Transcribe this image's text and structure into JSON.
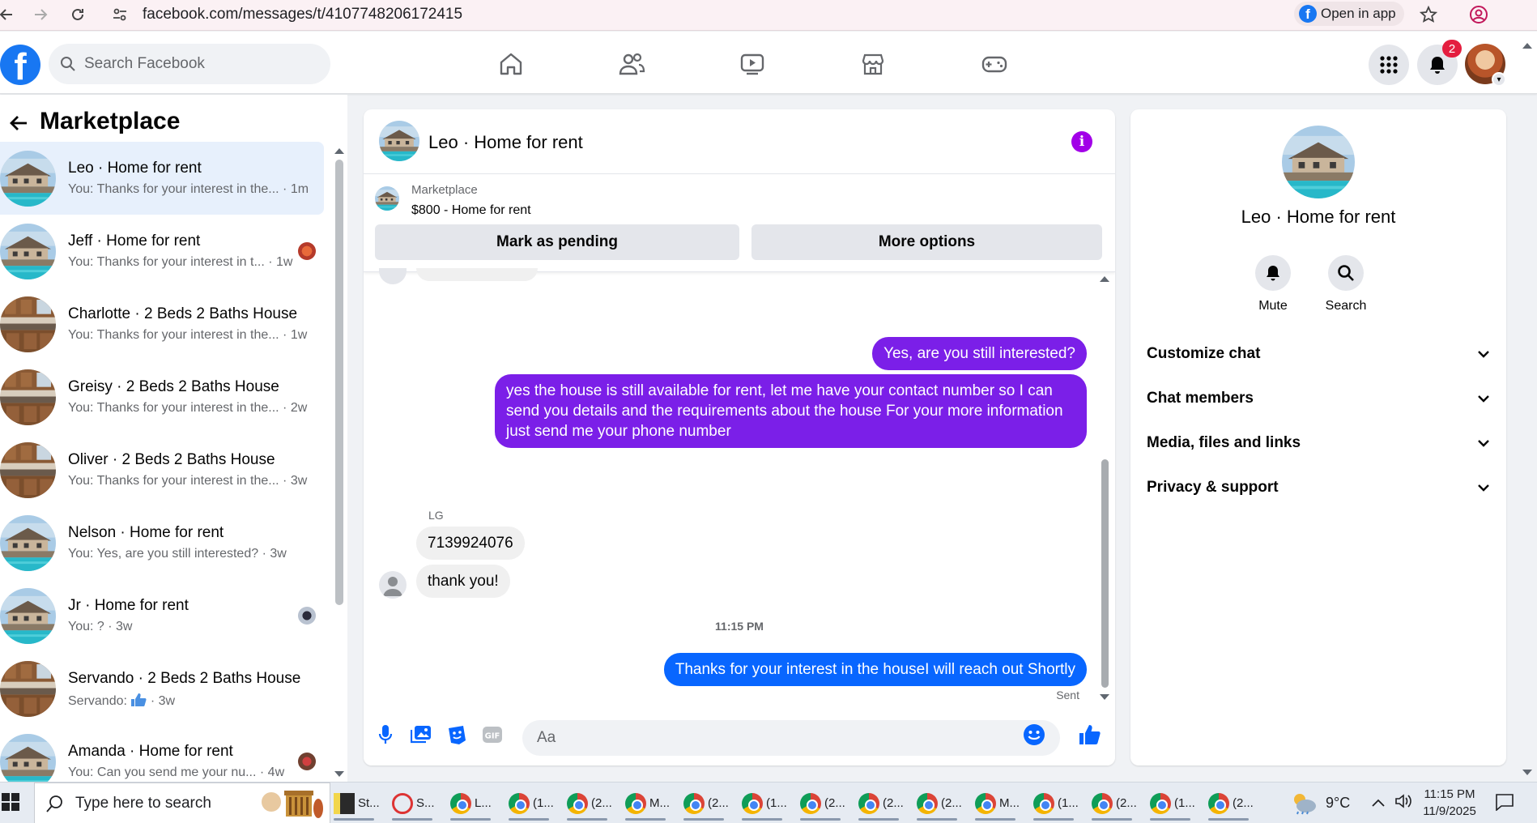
{
  "browser": {
    "url": "facebook.com/messages/t/4107748206172415",
    "open_in_app": "Open in app"
  },
  "header": {
    "search_placeholder": "Search Facebook",
    "notif_count": "2",
    "logo_letter": "f"
  },
  "sidebar": {
    "title": "Marketplace",
    "conversations": [
      {
        "name": "Leo · Home for rent",
        "preview": "You: Thanks for your interest in the...",
        "time": "· 1m",
        "image": "pool-house"
      },
      {
        "name": "Jeff · Home for rent",
        "preview": "You: Thanks for your interest in t...",
        "time": "· 1w",
        "image": "pool-house"
      },
      {
        "name": "Charlotte · 2 Beds 2 Baths House",
        "preview": "You: Thanks for your interest in the...",
        "time": "· 1w",
        "image": "kitchen"
      },
      {
        "name": "Greisy · 2 Beds 2 Baths House",
        "preview": "You: Thanks for your interest in the...",
        "time": "· 2w",
        "image": "kitchen"
      },
      {
        "name": "Oliver · 2 Beds 2 Baths House",
        "preview": "You: Thanks for your interest in the...",
        "time": "· 3w",
        "image": "kitchen"
      },
      {
        "name": "Nelson · Home for rent",
        "preview": "You: Yes, are you still interested?",
        "time": "· 3w",
        "image": "pool-house"
      },
      {
        "name": "Jr · Home for rent",
        "preview": "You: ?",
        "time": "· 3w",
        "image": "pool-house"
      },
      {
        "name": "Servando · 2 Beds 2 Baths House",
        "preview": "Servando:",
        "time": "· 3w",
        "image": "kitchen"
      },
      {
        "name": "Amanda · Home for rent",
        "preview": "You: Can you send me your nu...",
        "time": "· 4w",
        "image": "pool-house"
      }
    ]
  },
  "chat": {
    "title": "Leo · Home for rent",
    "marketplace_label": "Marketplace",
    "listing": "$800 - Home for rent",
    "mark_pending": "Mark as pending",
    "more_options": "More options",
    "messages": {
      "m1": "Yes, are you still interested?",
      "m2": "yes the house is still available for rent, let me have your contact number so I can send you details and the requirements about the house For  your  more  information  just  send  me   your  phone  number",
      "sender_label": "LG",
      "m3": "7139924076",
      "m4": "thank you!",
      "timestamp": "11:15 PM",
      "m5": "Thanks for your interest in the houseI will reach out Shortly",
      "status": "Sent"
    },
    "input_placeholder": "Aa"
  },
  "details": {
    "name": "Leo · Home for rent",
    "mute": "Mute",
    "search": "Search",
    "sections": [
      "Customize chat",
      "Chat members",
      "Media, files and links",
      "Privacy & support"
    ]
  },
  "taskbar": {
    "search_placeholder": "Type here to search",
    "apps": [
      "St...",
      "S...",
      "L...",
      "(1...",
      "(2...",
      "M...",
      "(2...",
      "(1...",
      "(2...",
      "(2...",
      "(2...",
      "M...",
      "(1...",
      "(2...",
      "(1...",
      "(2..."
    ],
    "temperature": "9°C",
    "time": "11:15 PM",
    "date": "11/9/2025"
  },
  "colors": {
    "fb_blue": "#1877f2",
    "bubble_purple": "#7b1fe8",
    "bubble_blue": "#0866ff",
    "info_purple": "#a200e8",
    "badge_red": "#e41e3f"
  }
}
